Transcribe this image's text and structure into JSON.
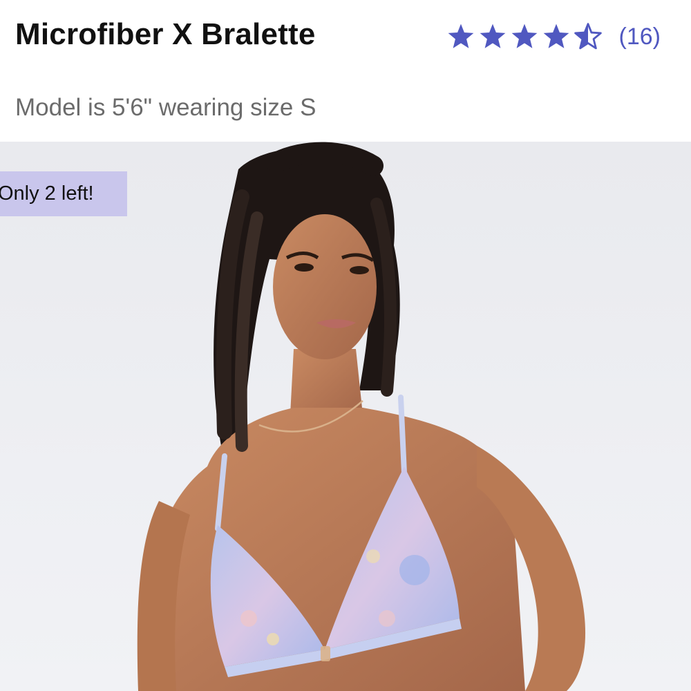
{
  "product": {
    "title": "Microfiber X Bralette",
    "model_info": "Model is 5'6\" wearing size S"
  },
  "rating": {
    "value": 4.5,
    "max": 5,
    "review_count_label": "(16)",
    "star_icons": [
      "star-full-icon",
      "star-full-icon",
      "star-full-icon",
      "star-full-icon",
      "star-half-icon"
    ],
    "star_color": "#5058c0"
  },
  "image": {
    "badge_label": "Only 2 left!",
    "badge_color": "#c9c6ec"
  }
}
